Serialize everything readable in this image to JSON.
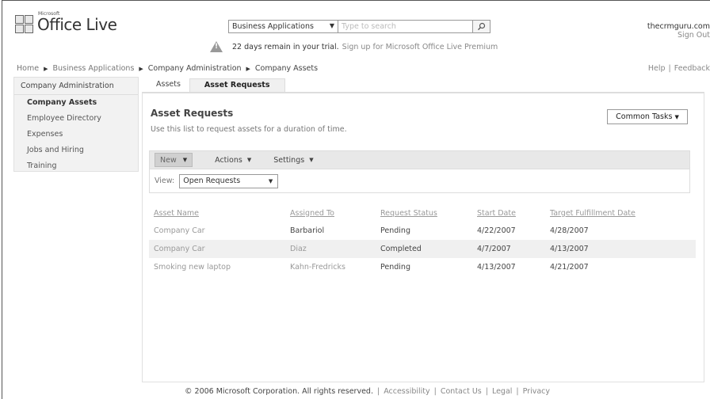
{
  "app": {
    "brand_small": "Microsoft",
    "brand": "Office Live"
  },
  "search": {
    "scope": "Business Applications",
    "placeholder": "Type to search"
  },
  "user": {
    "domain": "thecrmguru.com",
    "signout": "Sign Out"
  },
  "trial": {
    "message": "22 days remain in your trial.",
    "link": "Sign up for Microsoft Office Live Premium"
  },
  "breadcrumb": [
    "Home",
    "Business Applications",
    "Company Administration",
    "Company Assets"
  ],
  "help": {
    "help": "Help",
    "feedback": "Feedback"
  },
  "sidebar": {
    "header": "Company Administration",
    "items": [
      {
        "label": "Company Assets"
      },
      {
        "label": "Employee Directory"
      },
      {
        "label": "Expenses"
      },
      {
        "label": "Jobs and Hiring"
      },
      {
        "label": "Training"
      }
    ]
  },
  "tabs": [
    {
      "label": "Assets"
    },
    {
      "label": "Asset Requests"
    }
  ],
  "main": {
    "title": "Asset Requests",
    "description": "Use this list to request assets for a duration of time.",
    "common_tasks": "Common Tasks"
  },
  "toolbar": {
    "new": "New",
    "actions": "Actions",
    "settings": "Settings"
  },
  "view": {
    "label": "View:",
    "selected": "Open Requests"
  },
  "table": {
    "headers": [
      "Asset Name",
      "Assigned To",
      "Request Status",
      "Start Date",
      "Target Fulfillment Date"
    ],
    "rows": [
      [
        "Company Car",
        "Barbariol",
        "Pending",
        "4/22/2007",
        "4/28/2007"
      ],
      [
        "Company Car",
        "Diaz",
        "Completed",
        "4/7/2007",
        "4/13/2007"
      ],
      [
        "Smoking new laptop",
        "Kahn-Fredricks",
        "Pending",
        "4/13/2007",
        "4/21/2007"
      ]
    ]
  },
  "footer": {
    "copyright": "© 2006 Microsoft Corporation. All rights reserved.",
    "accessibility": "Accessibility",
    "contact": "Contact Us",
    "legal": "Legal",
    "privacy": "Privacy"
  }
}
